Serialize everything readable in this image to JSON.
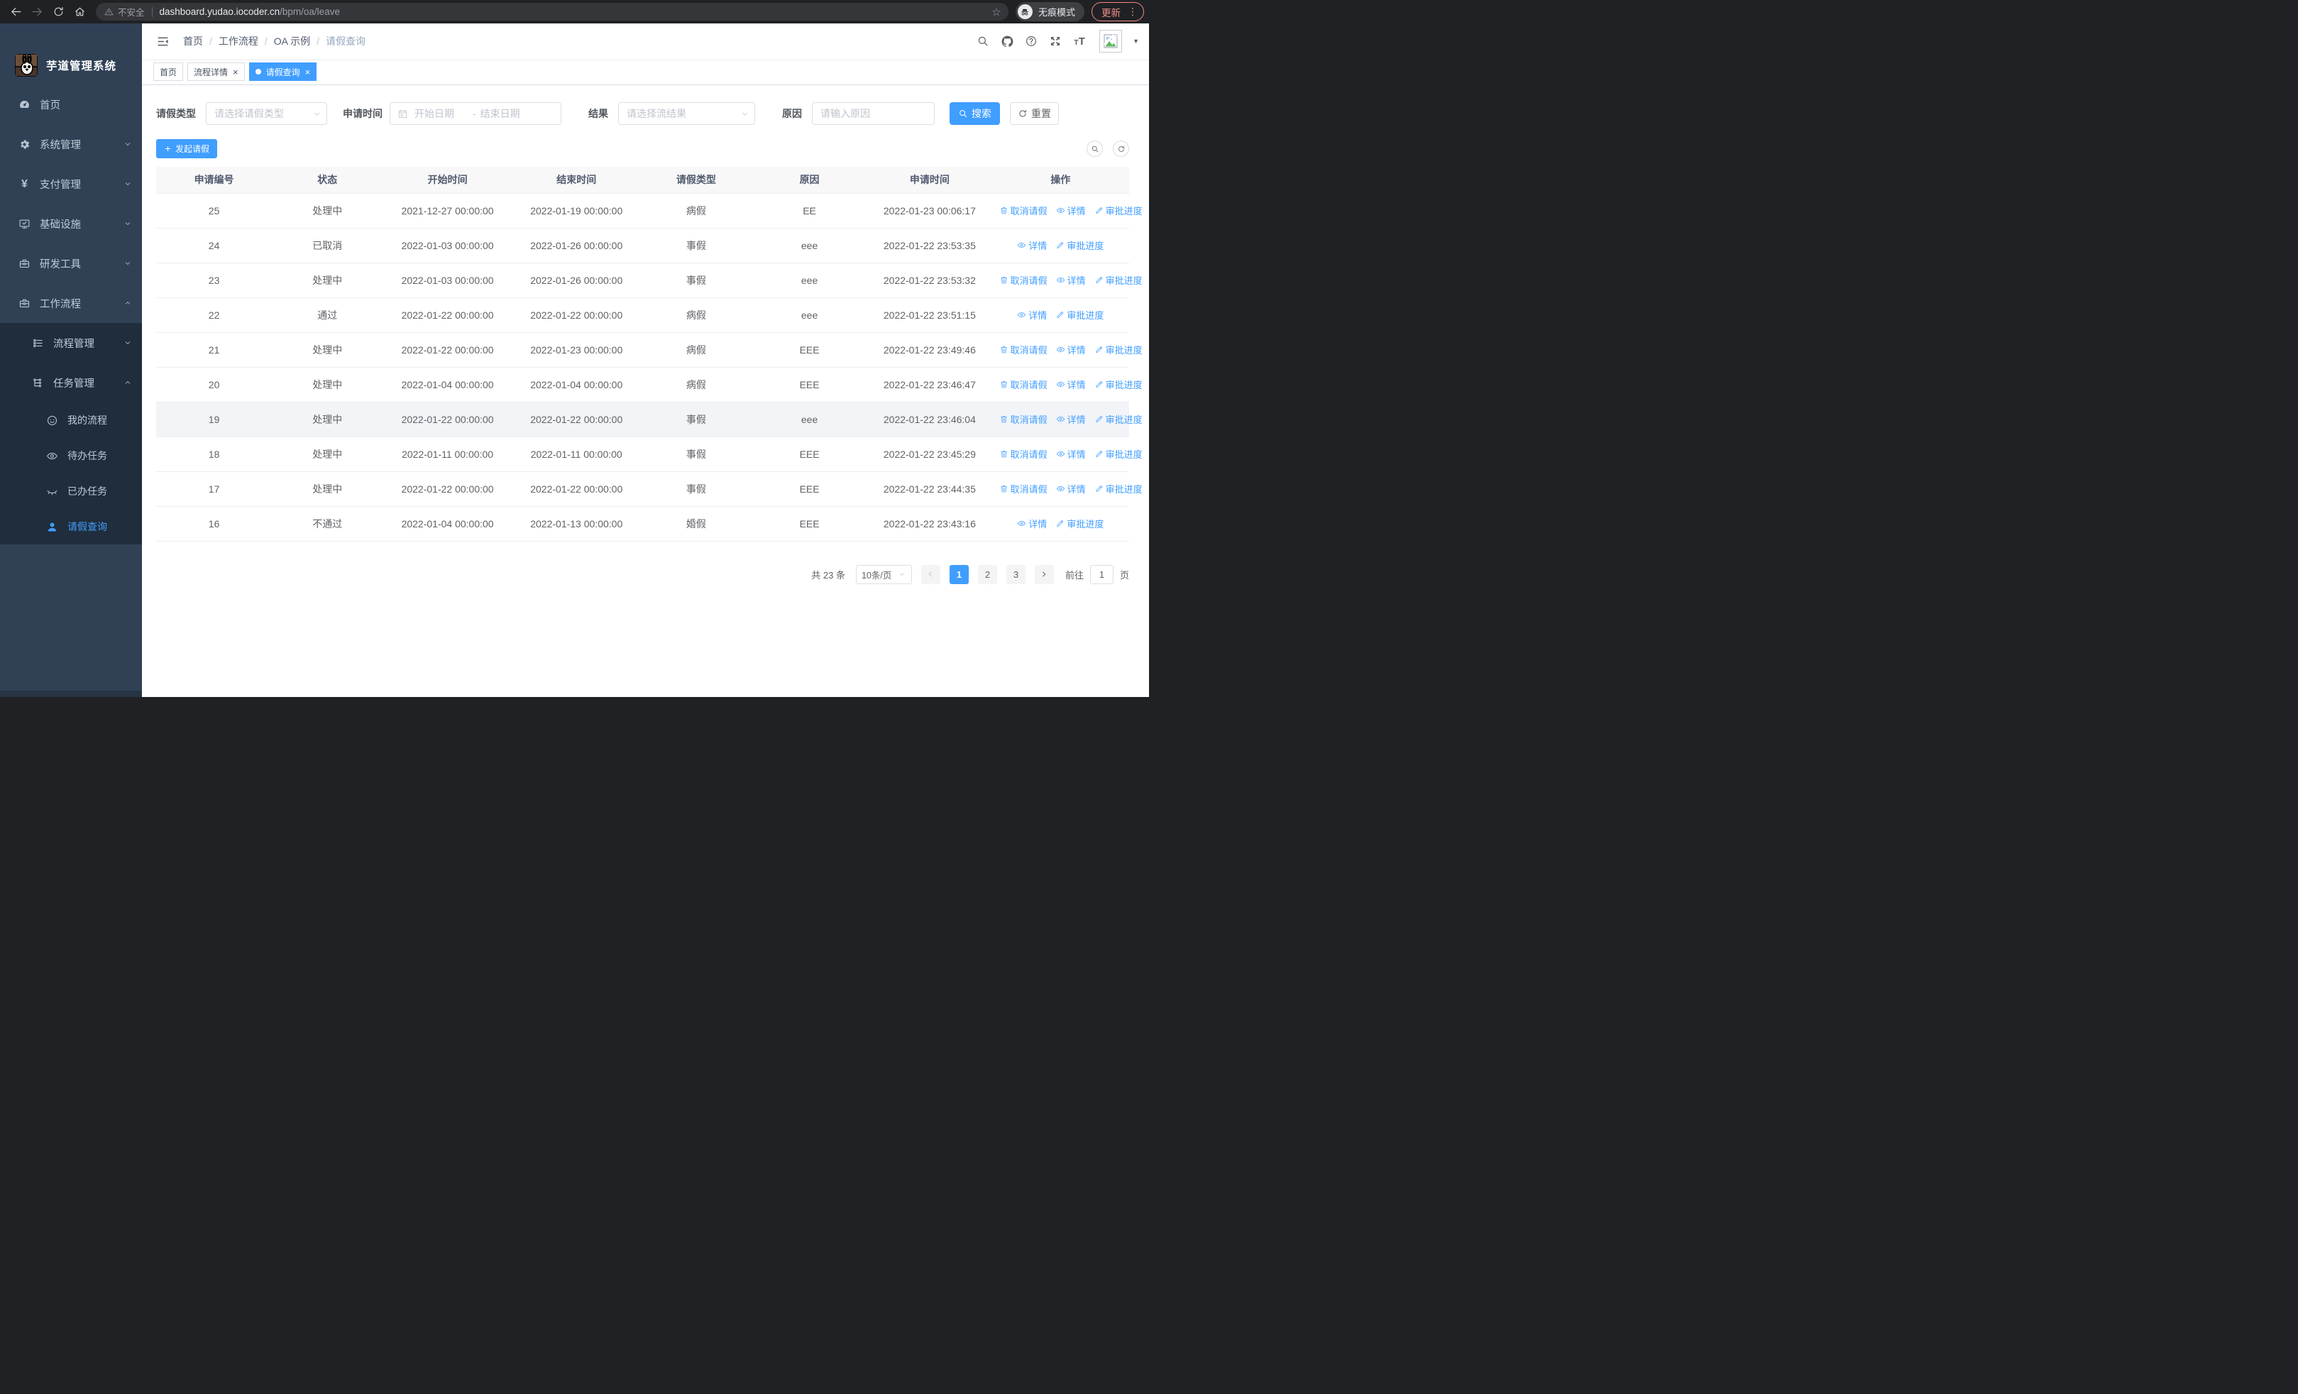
{
  "browser": {
    "secure_warning": "不安全",
    "url_host": "dashboard.yudao.iocoder.cn",
    "url_path": "/bpm/oa/leave",
    "incognito_label": "无痕模式",
    "update_label": "更新",
    "menu_dots": "⋮",
    "star": "☆"
  },
  "sidebar": {
    "app_title": "芋道管理系统",
    "items": [
      {
        "label": "首页",
        "icon": "dashboard-icon"
      },
      {
        "label": "系统管理",
        "icon": "gear-icon"
      },
      {
        "label": "支付管理",
        "icon": "yen-icon",
        "icon_glyph": "¥"
      },
      {
        "label": "基础设施",
        "icon": "monitor-icon"
      },
      {
        "label": "研发工具",
        "icon": "toolbox-icon"
      },
      {
        "label": "工作流程",
        "icon": "briefcase-icon"
      },
      {
        "label": "流程管理",
        "icon": "list-tree-icon"
      },
      {
        "label": "任务管理",
        "icon": "flow-icon"
      },
      {
        "label": "我的流程",
        "icon": "face-icon"
      },
      {
        "label": "待办任务",
        "icon": "eye-icon"
      },
      {
        "label": "已办任务",
        "icon": "eye-closed-icon"
      },
      {
        "label": "请假查询",
        "icon": "person-icon"
      }
    ]
  },
  "header": {
    "breadcrumb": [
      "首页",
      "工作流程",
      "OA 示例",
      "请假查询"
    ],
    "font_icon_small": "T",
    "font_icon_big": "T"
  },
  "tabs": [
    {
      "label": "首页"
    },
    {
      "label": "流程详情"
    },
    {
      "label": "请假查询"
    }
  ],
  "filters": {
    "leave_type_label": "请假类型",
    "leave_type_placeholder": "请选择请假类型",
    "apply_time_label": "申请时间",
    "start_placeholder": "开始日期",
    "range_separator": "-",
    "end_placeholder": "结束日期",
    "result_label": "结果",
    "result_placeholder": "请选择流结果",
    "reason_label": "原因",
    "reason_placeholder": "请输入原因",
    "search_label": "搜索",
    "reset_label": "重置"
  },
  "toolbar": {
    "create_label": "发起请假"
  },
  "table": {
    "columns": [
      "申请编号",
      "状态",
      "开始时间",
      "结束时间",
      "请假类型",
      "原因",
      "申请时间",
      "操作"
    ],
    "action_labels": {
      "cancel": "取消请假",
      "detail": "详情",
      "progress": "审批进度"
    },
    "rows": [
      {
        "id": "25",
        "status": "处理中",
        "start": "2021-12-27 00:00:00",
        "end": "2022-01-19 00:00:00",
        "type": "病假",
        "reason": "EE",
        "applied": "2022-01-23 00:06:17",
        "actions": [
          "cancel",
          "detail",
          "progress"
        ]
      },
      {
        "id": "24",
        "status": "已取消",
        "start": "2022-01-03 00:00:00",
        "end": "2022-01-26 00:00:00",
        "type": "事假",
        "reason": "eee",
        "applied": "2022-01-22 23:53:35",
        "actions": [
          "detail",
          "progress"
        ]
      },
      {
        "id": "23",
        "status": "处理中",
        "start": "2022-01-03 00:00:00",
        "end": "2022-01-26 00:00:00",
        "type": "事假",
        "reason": "eee",
        "applied": "2022-01-22 23:53:32",
        "actions": [
          "cancel",
          "detail",
          "progress"
        ]
      },
      {
        "id": "22",
        "status": "通过",
        "start": "2022-01-22 00:00:00",
        "end": "2022-01-22 00:00:00",
        "type": "病假",
        "reason": "eee",
        "applied": "2022-01-22 23:51:15",
        "actions": [
          "detail",
          "progress"
        ]
      },
      {
        "id": "21",
        "status": "处理中",
        "start": "2022-01-22 00:00:00",
        "end": "2022-01-23 00:00:00",
        "type": "病假",
        "reason": "EEE",
        "applied": "2022-01-22 23:49:46",
        "actions": [
          "cancel",
          "detail",
          "progress"
        ]
      },
      {
        "id": "20",
        "status": "处理中",
        "start": "2022-01-04 00:00:00",
        "end": "2022-01-04 00:00:00",
        "type": "病假",
        "reason": "EEE",
        "applied": "2022-01-22 23:46:47",
        "actions": [
          "cancel",
          "detail",
          "progress"
        ]
      },
      {
        "id": "19",
        "status": "处理中",
        "start": "2022-01-22 00:00:00",
        "end": "2022-01-22 00:00:00",
        "type": "事假",
        "reason": "eee",
        "applied": "2022-01-22 23:46:04",
        "actions": [
          "cancel",
          "detail",
          "progress"
        ],
        "highlight": true
      },
      {
        "id": "18",
        "status": "处理中",
        "start": "2022-01-11 00:00:00",
        "end": "2022-01-11 00:00:00",
        "type": "事假",
        "reason": "EEE",
        "applied": "2022-01-22 23:45:29",
        "actions": [
          "cancel",
          "detail",
          "progress"
        ]
      },
      {
        "id": "17",
        "status": "处理中",
        "start": "2022-01-22 00:00:00",
        "end": "2022-01-22 00:00:00",
        "type": "事假",
        "reason": "EEE",
        "applied": "2022-01-22 23:44:35",
        "actions": [
          "cancel",
          "detail",
          "progress"
        ]
      },
      {
        "id": "16",
        "status": "不通过",
        "start": "2022-01-04 00:00:00",
        "end": "2022-01-13 00:00:00",
        "type": "婚假",
        "reason": "EEE",
        "applied": "2022-01-22 23:43:16",
        "actions": [
          "detail",
          "progress"
        ]
      }
    ]
  },
  "pagination": {
    "total": "共 23 条",
    "page_size": "10条/页",
    "pages": [
      "1",
      "2",
      "3"
    ],
    "active_page": "1",
    "goto_label": "前往",
    "goto_value": "1",
    "unit_label": "页"
  },
  "colors": {
    "accent": "#409eff",
    "sidebar_bg": "#304156",
    "submenu_bg": "#1f2d3d",
    "update": "#f28b82"
  }
}
